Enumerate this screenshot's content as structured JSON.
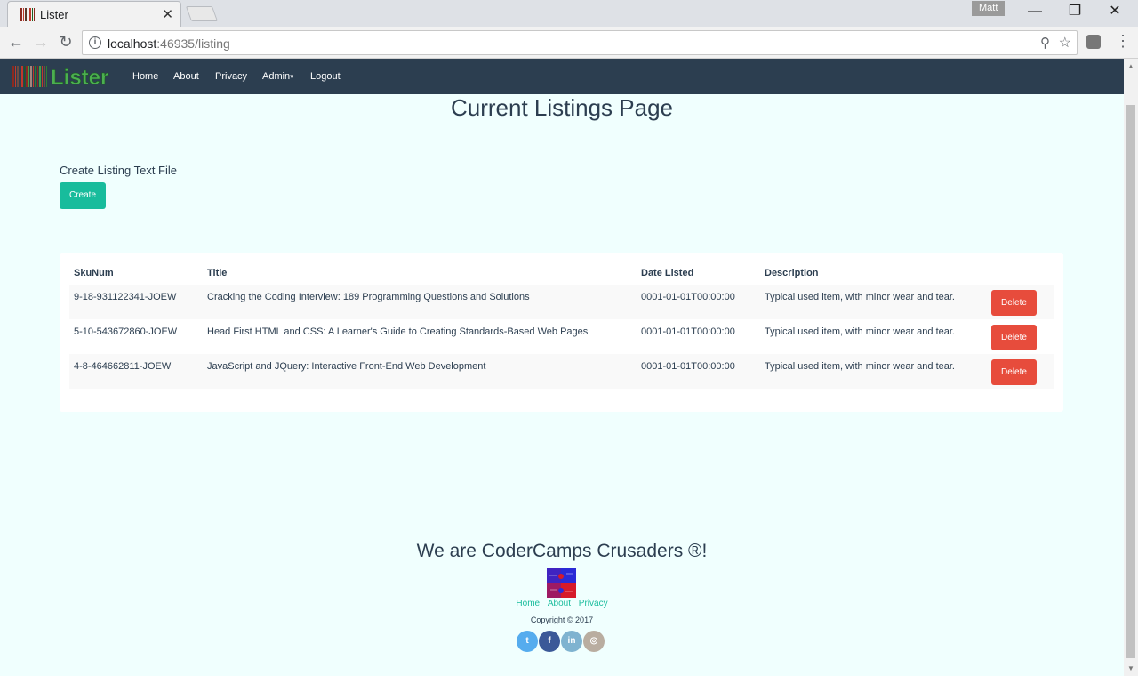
{
  "browser": {
    "tab_title": "Lister",
    "profile_name": "Matt",
    "url_host": "localhost",
    "url_rest": ":46935/listing"
  },
  "navbar": {
    "brand": "Lister",
    "items": [
      {
        "label": "Home"
      },
      {
        "label": "About"
      },
      {
        "label": "Privacy"
      },
      {
        "label": "Admin"
      },
      {
        "label": "Logout"
      }
    ]
  },
  "page": {
    "title": "Current Listings Page",
    "create_label": "Create Listing Text File",
    "create_button": "Create"
  },
  "table": {
    "headers": [
      "SkuNum",
      "Title",
      "Date Listed",
      "Description"
    ],
    "delete_label": "Delete",
    "rows": [
      {
        "sku": "9-18-931122341-JOEW",
        "title": "Cracking the Coding Interview: 189 Programming Questions and Solutions",
        "date": "0001-01-01T00:00:00",
        "description": "Typical used item, with minor wear and tear."
      },
      {
        "sku": "5-10-543672860-JOEW",
        "title": "Head First HTML and CSS: A Learner's Guide to Creating Standards-Based Web Pages",
        "date": "0001-01-01T00:00:00",
        "description": "Typical used item, with minor wear and tear."
      },
      {
        "sku": "4-8-464662811-JOEW",
        "title": "JavaScript and JQuery: Interactive Front-End Web Development",
        "date": "0001-01-01T00:00:00",
        "description": "Typical used item, with minor wear and tear."
      }
    ]
  },
  "footer": {
    "title": "We are CoderCamps Crusaders ®!",
    "links": [
      "Home",
      "About",
      "Privacy"
    ],
    "copyright": "Copyright © 2017",
    "social": [
      {
        "icon": "twitter-icon",
        "glyph": "t",
        "color": "#55acee"
      },
      {
        "icon": "facebook-icon",
        "glyph": "f",
        "color": "#3b5998"
      },
      {
        "icon": "linkedin-icon",
        "glyph": "in",
        "color": "#7fb3d0"
      },
      {
        "icon": "instagram-icon",
        "glyph": "◎",
        "color": "#b9ada0"
      }
    ]
  },
  "colors": {
    "navbar": "#2c3e50",
    "accent": "#18bc9c",
    "danger": "#e74c3c",
    "page_bg": "#f0fffe"
  }
}
